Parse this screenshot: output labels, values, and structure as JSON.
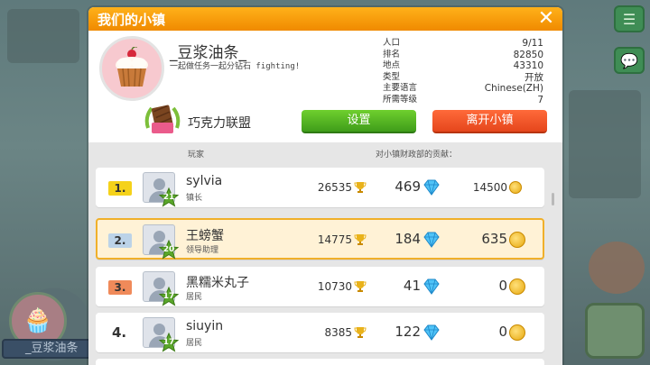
{
  "modal": {
    "title": "我们的小镇",
    "close_glyph": "✕"
  },
  "town": {
    "name": "_豆浆油条_",
    "slogan": "一起做任务一起分钻石 fighting!",
    "avatar_icon": "cupcake-icon",
    "info": [
      {
        "label": "人口",
        "value": "9/11"
      },
      {
        "label": "排名",
        "value": "82850"
      },
      {
        "label": "地点",
        "value": "43310"
      },
      {
        "label": "类型",
        "value": "开放"
      },
      {
        "label": "主要语言",
        "value": "Chinese(ZH)"
      },
      {
        "label": "所需等级",
        "value": "7"
      }
    ],
    "alliance": {
      "name": "巧克力联盟",
      "icon": "chocolate-emblem-icon"
    }
  },
  "buttons": {
    "settings": "设置",
    "leave": "离开小镇"
  },
  "table": {
    "col_player": "玩家",
    "col_contribution": "对小镇财政部的贡献："
  },
  "rows": [
    {
      "rank": "1.",
      "rank_color": "#f5d21a",
      "name": "sylvia",
      "role": "镇长",
      "level": "21",
      "trophies": "26535",
      "gems": "469",
      "coins": "14500"
    },
    {
      "rank": "2.",
      "rank_color": "#bcd3e8",
      "name": "王螃蟹",
      "role": "领导助理",
      "level": "20",
      "trophies": "14775",
      "gems": "184",
      "coins": "635"
    },
    {
      "rank": "3.",
      "rank_color": "#f08a5a",
      "name": "黑糯米丸子",
      "role": "居民",
      "level": "17",
      "trophies": "10730",
      "gems": "41",
      "coins": "0"
    },
    {
      "rank": "4.",
      "rank_color": "",
      "name": "siuyin",
      "role": "居民",
      "level": "17",
      "trophies": "8385",
      "gems": "122",
      "coins": "0"
    }
  ],
  "background": {
    "player_name": "_豆浆油条",
    "side_icons": [
      "list-icon",
      "chat-icon"
    ]
  },
  "colors": {
    "title_bar": "#f59a0a",
    "settings_button": "#4fb321",
    "leave_button": "#ee5323",
    "highlight_border": "#f0b02a"
  }
}
